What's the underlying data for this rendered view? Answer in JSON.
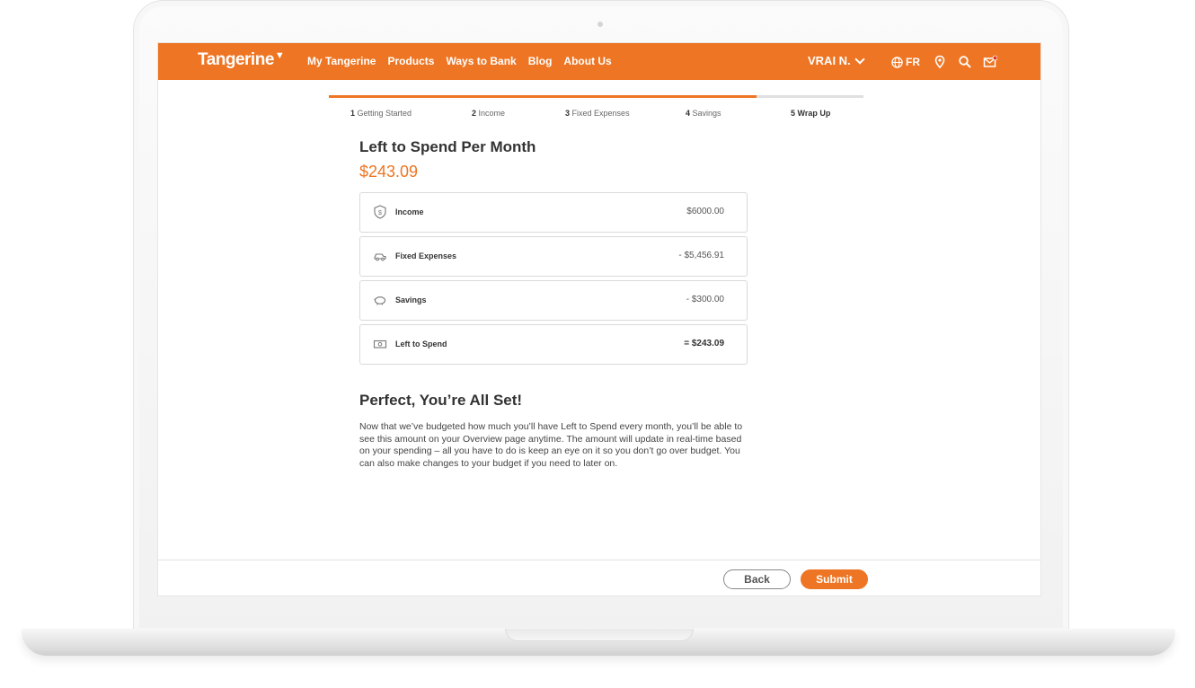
{
  "header": {
    "logo": "Tangerine",
    "nav": [
      "My Tangerine",
      "Products",
      "Ways to Bank",
      "Blog",
      "About Us"
    ],
    "user": "VRAI N.",
    "language": "FR",
    "icons": [
      "globe-icon",
      "location-pin-icon",
      "search-icon",
      "mail-icon"
    ]
  },
  "steps": [
    {
      "num": "1",
      "label": "Getting Started"
    },
    {
      "num": "2",
      "label": "Income"
    },
    {
      "num": "3",
      "label": "Fixed Expenses"
    },
    {
      "num": "4",
      "label": "Savings"
    },
    {
      "num": "5",
      "label": "Wrap Up"
    }
  ],
  "progress_fraction": 0.8,
  "summary": {
    "title": "Left to Spend Per Month",
    "amount": "$243.09",
    "rows": [
      {
        "label": "Income",
        "value": "$6000.00",
        "icon": "dollar-shield-icon"
      },
      {
        "label": "Fixed Expenses",
        "value": "- $5,456.91",
        "icon": "car-icon"
      },
      {
        "label": "Savings",
        "value": "- $300.00",
        "icon": "piggy-bank-icon"
      },
      {
        "label": "Left to Spend",
        "value": "= $243.09",
        "icon": "cash-icon"
      }
    ]
  },
  "wrapup": {
    "title": "Perfect, You’re All Set!",
    "text": "Now that we’ve budgeted how much you’ll have Left to Spend every month, you’ll be able to see this amount on your Overview page anytime. The amount will update in real-time based on your spending – all you have to do is keep an eye on it so you don’t go over budget. You can also make changes to your budget if you need to later on."
  },
  "buttons": {
    "back": "Back",
    "submit": "Submit"
  },
  "colors": {
    "accent": "#ee7523"
  }
}
